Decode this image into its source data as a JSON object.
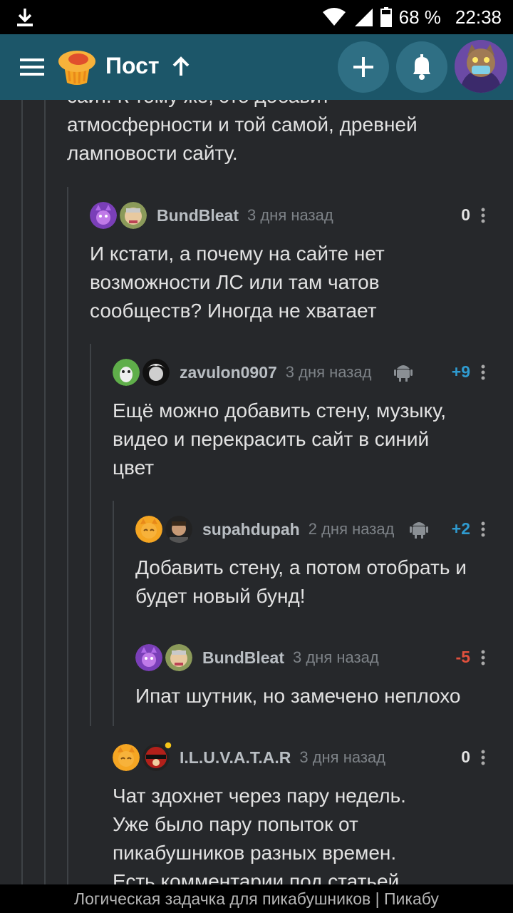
{
  "status_bar": {
    "battery": "68 %",
    "time": "22:38"
  },
  "app_bar": {
    "title": "Пост"
  },
  "comments": [
    {
      "text_lines": [
        "сайт. К тому же, это добавит",
        "атмосферности и той самой, древней",
        "ламповости сайту."
      ]
    },
    {
      "username": "BundBleat",
      "date": "3 дня назад",
      "score": "0",
      "score_color": "#e2e2e2",
      "text_lines": [
        "И кстати, а почему на сайте нет",
        "возможности ЛС или там чатов",
        "сообществ? Иногда не хватает"
      ]
    },
    {
      "username": "zavulon0907",
      "date": "3 дня назад",
      "score": "+9",
      "score_color": "#2f9bd0",
      "text_lines": [
        "Ещё можно добавить стену, музыку,",
        "видео и перекрасить сайт в синий",
        "цвет"
      ]
    },
    {
      "username": "supahdupah",
      "date": "2 дня назад",
      "score": "+2",
      "score_color": "#2f9bd0",
      "text_lines": [
        "Добавить стену, а потом отобрать и",
        "будет новый бунд!"
      ]
    },
    {
      "username": "BundBleat",
      "date": "3 дня назад",
      "score": "-5",
      "score_color": "#e0503d",
      "text_lines": [
        "Ипат шутник, но замечено неплохо"
      ]
    },
    {
      "username": "I.L.U.V.A.T.A.R",
      "date": "3 дня назад",
      "score": "0",
      "score_color": "#e2e2e2",
      "text_lines": [
        "Чат здохнет через пару недель.",
        "Уже было пару попыток от",
        "пикабушников разных времен.",
        "Есть комментарии под статьей"
      ]
    }
  ],
  "bottom_bar": {
    "title": "Логическая задачка для пикабушников | Пикабу"
  }
}
